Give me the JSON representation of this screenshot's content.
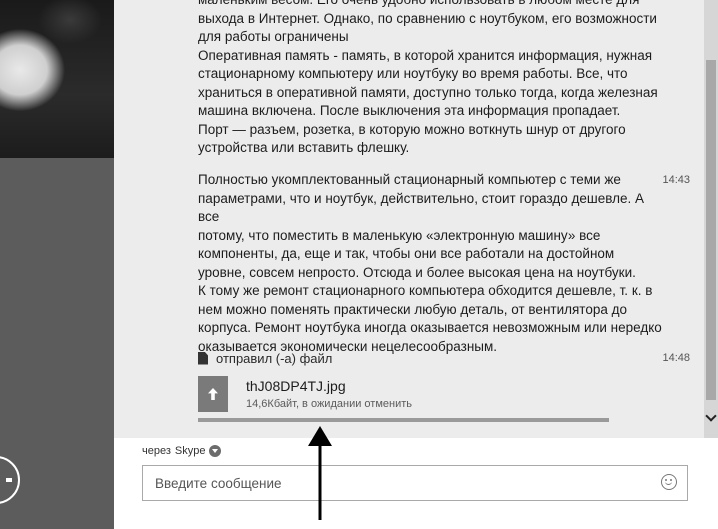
{
  "chat": {
    "message1_lines": [
      "маленьким весом. Его очень удобно использовать  в любом месте для",
      "выхода в Интернет. Однако, по сравнению с ноутбуком, его возможности",
      "для работы ограничены",
      "Оперативная память - память, в которой хранится информация, нужная",
      "стационарному компьютеру или ноутбуку во время работы.  Все, что",
      "храниться в оперативной памяти, доступно только тогда, когда железная",
      "машина включена. После выключения эта информация пропадает.",
      "Порт  — разъем, розетка, в которую можно воткнуть шнур от другого",
      "устройства  или вставить флешку."
    ],
    "message2_lines": [
      "Полностью укомплектованный стационарный компьютер с теми же",
      "параметрами, что и ноутбук, действительно, стоит гораздо дешевле. А все",
      "потому, что поместить в маленькую «электронную машину» все",
      "компоненты, да, еще и так, чтобы они все работали на достойном",
      "уровне, совсем непросто. Отсюда и более высокая цена на ноутбуки.",
      "К тому же ремонт стационарного компьютера обходится дешевле, т. к. в",
      "нем можно поменять практически любую деталь, от вентилятора до",
      "корпуса. Ремонт ноутбука иногда оказывается невозможным или нередко",
      "оказывается экономически нецелесообразным."
    ],
    "message2_time": "14:43",
    "file_event": {
      "label": "отправил (-а) файл",
      "time": "14:48",
      "icon": "document-icon"
    },
    "file": {
      "name": "thJ08DP4TJ.jpg",
      "status_prefix": "14,6Кбайт, в ожидании",
      "cancel_label": "отменить",
      "progress": 0
    }
  },
  "compose": {
    "via_prefix": "через",
    "via_service": "Skype",
    "placeholder": "Введите сообщение",
    "emoji_icon": "smiley-icon"
  },
  "colors": {
    "chat_background": "#ececec",
    "left_panel": "#5c5c5c",
    "progress_track": "#9a9a9a"
  }
}
